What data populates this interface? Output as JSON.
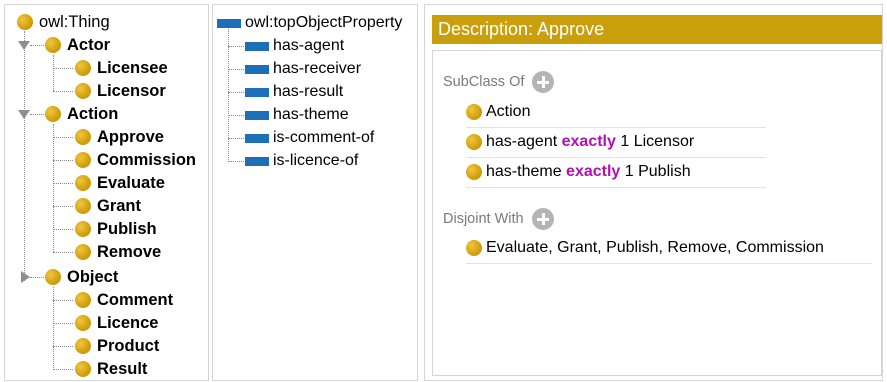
{
  "class_hierarchy": {
    "root": "owl:Thing",
    "groups": [
      {
        "label": "Actor",
        "expanded": true,
        "children": [
          "Licensee",
          "Licensor"
        ]
      },
      {
        "label": "Action",
        "expanded": true,
        "children": [
          "Approve",
          "Commission",
          "Evaluate",
          "Grant",
          "Publish",
          "Remove"
        ]
      },
      {
        "label": "Object",
        "expanded": false,
        "children": [
          "Comment",
          "Licence",
          "Product",
          "Result"
        ]
      }
    ]
  },
  "object_properties": {
    "root": "owl:topObjectProperty",
    "children": [
      "has-agent",
      "has-receiver",
      "has-result",
      "has-theme",
      "is-comment-of",
      "is-licence-of"
    ]
  },
  "description": {
    "header": "Description: Approve",
    "subclass_of": {
      "title": "SubClass Of",
      "items": [
        {
          "before": "Action",
          "keyword": "",
          "after": ""
        },
        {
          "before": "has-agent",
          "keyword": "exactly",
          "after": "1 Licensor"
        },
        {
          "before": "has-theme",
          "keyword": "exactly",
          "after": "1 Publish"
        }
      ]
    },
    "disjoint_with": {
      "title": "Disjoint With",
      "items": [
        {
          "before": "Evaluate, Grant, Publish, Remove, Commission",
          "keyword": "",
          "after": ""
        }
      ]
    }
  },
  "colors": {
    "header_bg": "#c99f0c",
    "class_dot": "#d4a20f",
    "property_bar": "#1c6fb8",
    "keyword": "#b012b5"
  }
}
